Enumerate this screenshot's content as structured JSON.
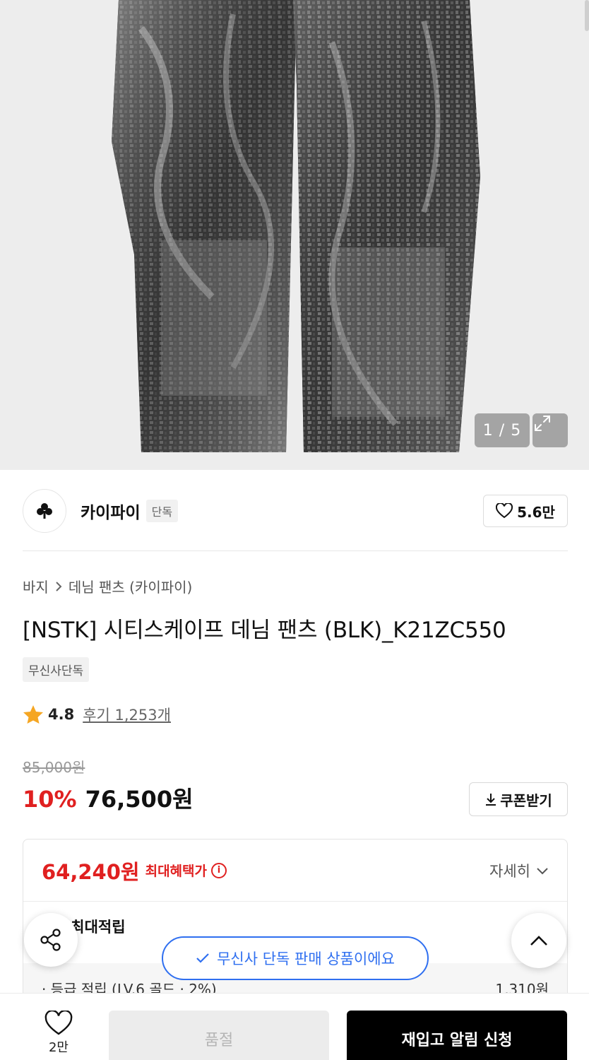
{
  "gallery": {
    "counter": "1 / 5"
  },
  "brand": {
    "name": "카이파이",
    "badge": "단독",
    "likes": "5.6만"
  },
  "product": {
    "breadcrumb": [
      "바지",
      "데님 팬츠 (카이파이)"
    ],
    "title": "[NSTK] 시티스케이프 데님 팬츠 (BLK)_K21ZC550",
    "tag": "무신사단독",
    "rating": "4.8",
    "reviews": "후기 1,253개",
    "original_price": "85,000원",
    "discount": "10%",
    "price": "76,500원",
    "coupon_label": "쿠폰받기"
  },
  "benefit": {
    "max_price": "64,240원",
    "max_label": "최대혜택가",
    "detail_label": "자세히",
    "points_label": "0원 최대적립",
    "grade_label": "· 등급 적립 (LV.6 골드 · 2%)",
    "grade_value": "1,310원"
  },
  "toast": {
    "message": "무신사 단독 판매 상품이에요"
  },
  "bottom": {
    "wish_count": "2만",
    "soldout_label": "품절",
    "restock_label": "재입고 알림 신청"
  },
  "colors": {
    "accent_red": "#e02020",
    "toast_blue": "#2f6ff0",
    "primary_black": "#000000"
  },
  "icons": [
    "expand-icon",
    "heart-icon",
    "chevron-right-icon",
    "star-icon",
    "download-icon",
    "info-icon",
    "chevron-down-icon",
    "share-icon",
    "chevron-up-icon",
    "check-icon"
  ]
}
